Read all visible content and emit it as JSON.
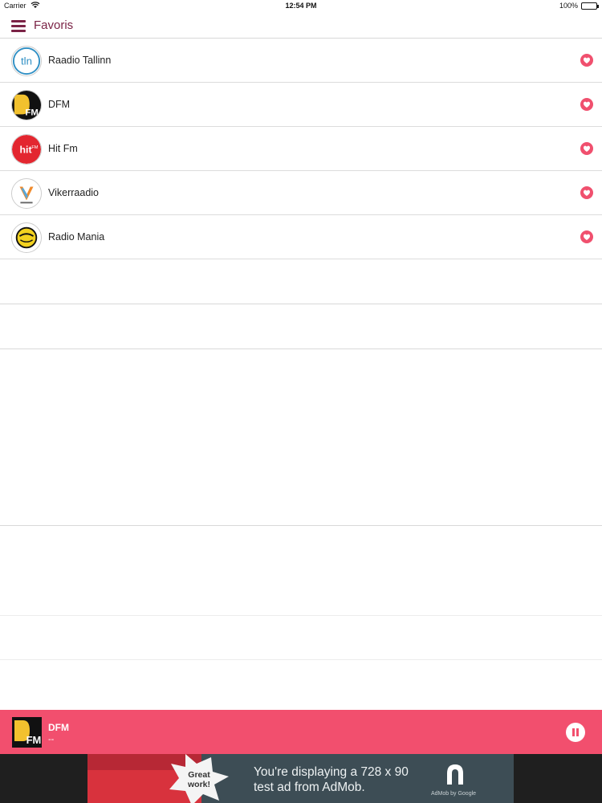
{
  "status_bar": {
    "carrier": "Carrier",
    "time": "12:54 PM",
    "battery": "100%"
  },
  "header": {
    "title": "Favoris"
  },
  "stations": [
    {
      "name": "Raadio Tallinn",
      "logo": "tln-logo"
    },
    {
      "name": "DFM",
      "logo": "dfm-logo"
    },
    {
      "name": "Hit Fm",
      "logo": "hitfm-logo"
    },
    {
      "name": "Vikerraadio",
      "logo": "vikerraadio-logo"
    },
    {
      "name": "Radio Mania",
      "logo": "radiomania-logo"
    }
  ],
  "player": {
    "station": "DFM",
    "subtitle": "--",
    "state": "playing"
  },
  "ad": {
    "badge": "Great work!",
    "line1": "You're displaying a 728 x 90",
    "line2": "test ad from AdMob.",
    "credit": "AdMob by Google"
  },
  "colors": {
    "accent": "#7b2346",
    "player_bg": "#f24f6e",
    "favorite": "#f0506e"
  }
}
